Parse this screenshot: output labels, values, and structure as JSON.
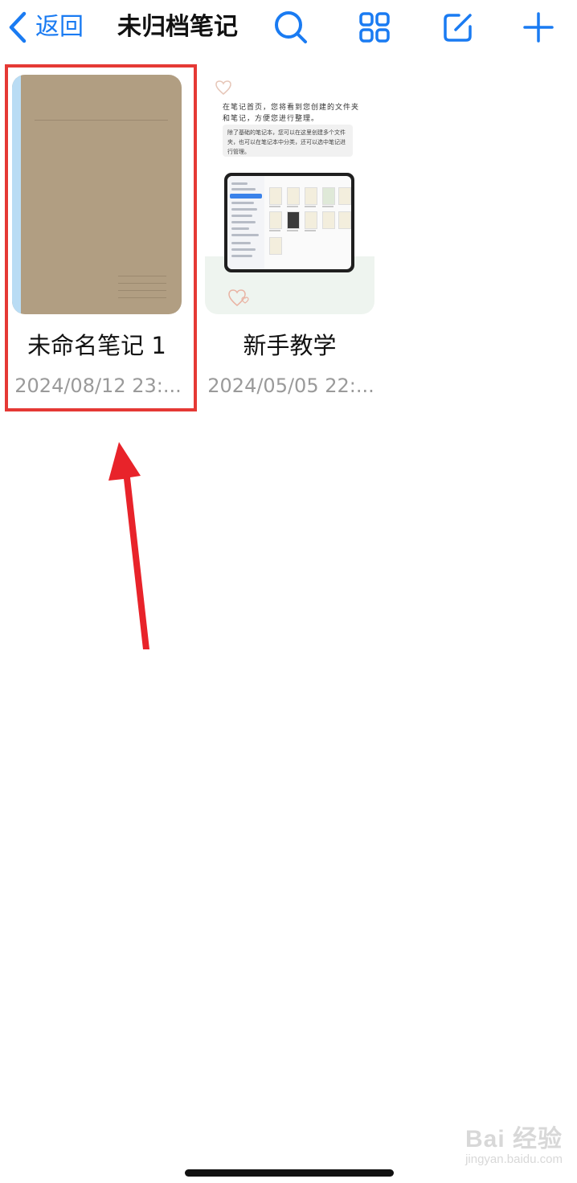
{
  "nav": {
    "back_label": "返回",
    "title": "未归档笔记",
    "icons": [
      "chevron-left-icon",
      "search-icon",
      "grid-icon",
      "edit-icon",
      "plus-icon"
    ],
    "accent_color": "#1a7bf2"
  },
  "notes": [
    {
      "title": "未命名笔记 1",
      "date": "2024/08/12 23:...",
      "cover_color": "#b19e82",
      "spine_color": "#b9dcf4",
      "highlighted": true
    },
    {
      "title": "新手教学",
      "date": "2024/05/05 22:...",
      "cover_text_1": "在笔记首页，您将看到您创建的文件夹和笔记，方便您进行整理。",
      "cover_text_2": "除了基础的笔记本，您可以在这里创建多个文件夹，也可以在笔记本中分类，还可以选中笔记进行管理。"
    }
  ],
  "annotation": {
    "highlight_color": "#e53935",
    "arrow_color": "#e8232a"
  },
  "watermark": {
    "main": "Bai 经验",
    "sub": "jingyan.baidu.com"
  }
}
